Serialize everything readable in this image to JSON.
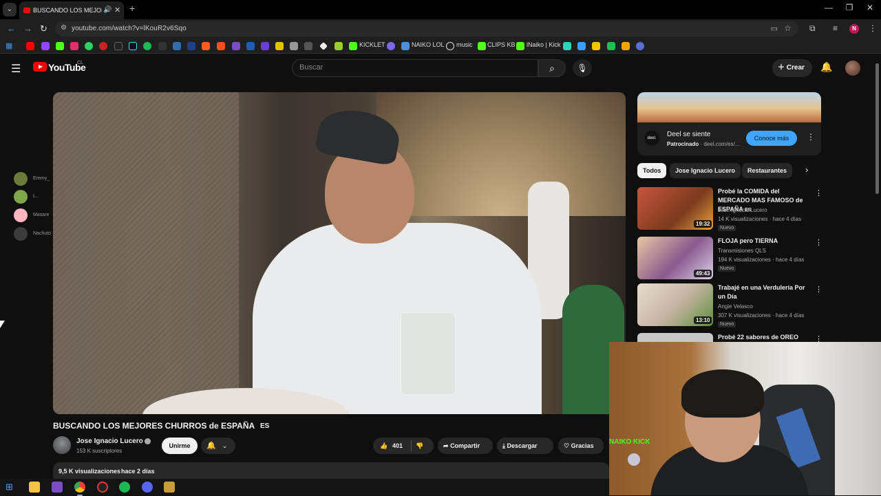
{
  "browser": {
    "tab_title": "BUSCANDO LOS MEJORES",
    "tab_audio_icon": "speaker-icon",
    "url": "youtube.com/watch?v=lKouR2v6Sqo",
    "profile_initial": "N",
    "bookmarks": [
      {
        "label": "KICKLET",
        "color": "#53fc18"
      },
      {
        "label": "NAIKO LOL",
        "color": "#4a90d9"
      },
      {
        "label": "music",
        "color": "#ffffff"
      },
      {
        "label": "CLIPS KB",
        "color": "#53fc18"
      },
      {
        "label": "lNaiko | Kick",
        "color": "#53fc18"
      }
    ]
  },
  "youtube": {
    "logo_text": "YouTube",
    "country_code": "CL",
    "search_placeholder": "Buscar",
    "create_label": "Crear"
  },
  "overlay_users": [
    {
      "name": "Eremy_",
      "color": "#6c7a3a"
    },
    {
      "name": "L..",
      "color": "#7fa64a"
    },
    {
      "name": "Masare",
      "color": "#ffb6c1"
    },
    {
      "name": "Nachuto",
      "color": "#3b3b3b"
    }
  ],
  "video": {
    "title": "BUSCANDO LOS MEJORES CHURROS de ESPAÑA",
    "title_lang": "ES",
    "channel_name": "Jose Ignacio Lucero",
    "subscribers": "153 K suscriptores",
    "join_label": "Unirme",
    "like_count": "401",
    "share_label": "Compartir",
    "download_label": "Descargar",
    "thanks_label": "Gracias",
    "views": "9,5 K visualizaciones",
    "date": "hace 2 días"
  },
  "ad": {
    "title": "Deel se siente",
    "sponsored": "Patrocinado",
    "domain": "· deel.com/es/...",
    "cta": "Conoce más",
    "logo_text": "deel."
  },
  "chips": [
    {
      "label": "Todos",
      "active": true
    },
    {
      "label": "Jose Ignacio Lucero",
      "active": false
    },
    {
      "label": "Restaurantes",
      "active": false
    }
  ],
  "recommendations": [
    {
      "title": "Probé la COMIDA del MERCADO MAS FAMOSO de ESPAÑA",
      "lang": "ES",
      "channel": "Jose Ignacio Lucero",
      "meta": "14 K visualizaciones · hace 4 días",
      "badge": "Nuevo",
      "duration": "19:32",
      "thumb": "#b5412c"
    },
    {
      "title": "FLOJA pero TIERNA",
      "lang": "",
      "channel": "Transmisiones QLS",
      "meta": "194 K visualizaciones · hace 4 días",
      "badge": "Nuevo",
      "duration": "49:43",
      "thumb": "#8a5a8c"
    },
    {
      "title": "Trabajé en una Verdulería Por un Día",
      "lang": "",
      "channel": "Angie Velasco",
      "meta": "307 K visualizaciones · hace 4 días",
      "badge": "Nuevo",
      "duration": "13:10",
      "thumb": "#d9c7b8"
    },
    {
      "title": "Probé 22 sabores de OREO",
      "lang": "",
      "channel": "",
      "meta": "",
      "badge": "",
      "duration": "",
      "thumb": "#c8c8c8"
    }
  ],
  "webcam": {
    "kick_text": "NAIKO KICK"
  }
}
